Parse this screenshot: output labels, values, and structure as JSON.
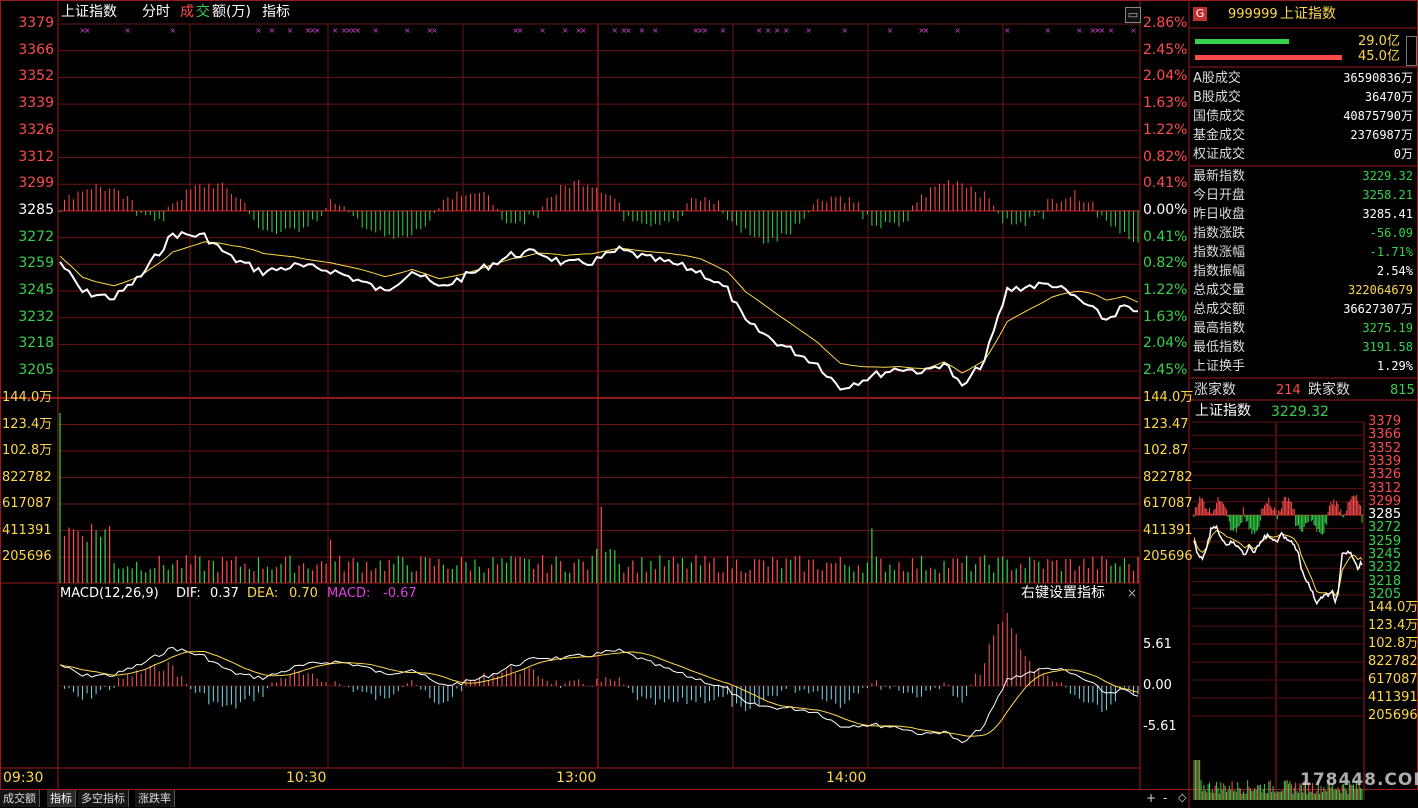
{
  "header": {
    "title": "上证指数",
    "tab_fenshi": "分时",
    "tab_cheng": "成",
    "tab_jiao": "交",
    "tab_e": "额(万)",
    "tab_zhibiao": "指标"
  },
  "price_axis_left": [
    "3379",
    "3366",
    "3352",
    "3339",
    "3326",
    "3312",
    "3299",
    "3285",
    "3272",
    "3259",
    "3245",
    "3232",
    "3218",
    "3205"
  ],
  "price_axis_right": [
    "2.86%",
    "2.45%",
    "2.04%",
    "1.63%",
    "1.22%",
    "0.82%",
    "0.41%",
    "0.00%",
    "0.41%",
    "0.82%",
    "1.22%",
    "1.63%",
    "2.04%",
    "2.45%"
  ],
  "volume_axis_left": [
    "144.0万",
    "123.4万",
    "102.8万",
    "822782",
    "617087",
    "411391",
    "205696"
  ],
  "volume_axis_right": [
    "144.0万",
    "123.47",
    "102.87",
    "822782",
    "617087",
    "411391",
    "205696"
  ],
  "macd": {
    "label": "MACD(12,26,9)",
    "dif_label": "DIF:",
    "dif_value": "0.37",
    "dea_label": "DEA:",
    "dea_value": "0.70",
    "macd_label": "MACD:",
    "macd_value": "-0.67",
    "axis": [
      "5.61",
      "0.00",
      "-5.61"
    ],
    "settings_link": "右键设置指标",
    "close": "×"
  },
  "time_axis": [
    "09:30",
    "10:30",
    "13:00",
    "14:00"
  ],
  "bottom_tabs": [
    "成交额",
    "指标",
    "多空指标",
    "涨跌率"
  ],
  "bottom_controls": [
    "+",
    "-",
    "◇"
  ],
  "right_panel": {
    "badge": "G",
    "code": "999999",
    "name": "上证指数",
    "bar_green_value": "29.0亿",
    "bar_red_value": "45.0亿",
    "turnover_rows": [
      {
        "label": "A股成交",
        "value": "36590836万"
      },
      {
        "label": "B股成交",
        "value": "36470万"
      },
      {
        "label": "国债成交",
        "value": "40875790万"
      },
      {
        "label": "基金成交",
        "value": "2376987万"
      },
      {
        "label": "权证成交",
        "value": "0万"
      }
    ],
    "quote_rows": [
      {
        "label": "最新指数",
        "value": "3229.32",
        "color": "green"
      },
      {
        "label": "今日开盘",
        "value": "3258.21",
        "color": "green"
      },
      {
        "label": "昨日收盘",
        "value": "3285.41",
        "color": "white"
      },
      {
        "label": "指数涨跌",
        "value": "-56.09",
        "color": "green"
      },
      {
        "label": "指数涨幅",
        "value": "-1.71%",
        "color": "green"
      },
      {
        "label": "指数振幅",
        "value": "2.54%",
        "color": "white"
      },
      {
        "label": "总成交量",
        "value": "322064679",
        "color": "yellow"
      },
      {
        "label": "总成交额",
        "value": "36627307万",
        "color": "white"
      },
      {
        "label": "最高指数",
        "value": "3275.19",
        "color": "green"
      },
      {
        "label": "最低指数",
        "value": "3191.58",
        "color": "green"
      },
      {
        "label": "上证换手",
        "value": "1.29%",
        "color": "white"
      }
    ],
    "rise_label": "涨家数",
    "rise_value": "214",
    "fall_label": "跌家数",
    "fall_value": "815",
    "mini_title": "上证指数",
    "mini_price": "3229.32",
    "mini_axis": [
      "3379",
      "3366",
      "3352",
      "3339",
      "3326",
      "3312",
      "3299",
      "3285",
      "3272",
      "3259",
      "3245",
      "3232",
      "3218",
      "3205",
      "144.0万",
      "123.4万",
      "102.8万",
      "822782",
      "617087",
      "411391",
      "205696"
    ]
  },
  "watermark": "178448.COM",
  "colors": {
    "up": "#ff4b4b",
    "down": "#35d24a",
    "grid": "#8b1a1a",
    "price_line": "#ffffff",
    "avg_line": "#ffd84a"
  }
}
